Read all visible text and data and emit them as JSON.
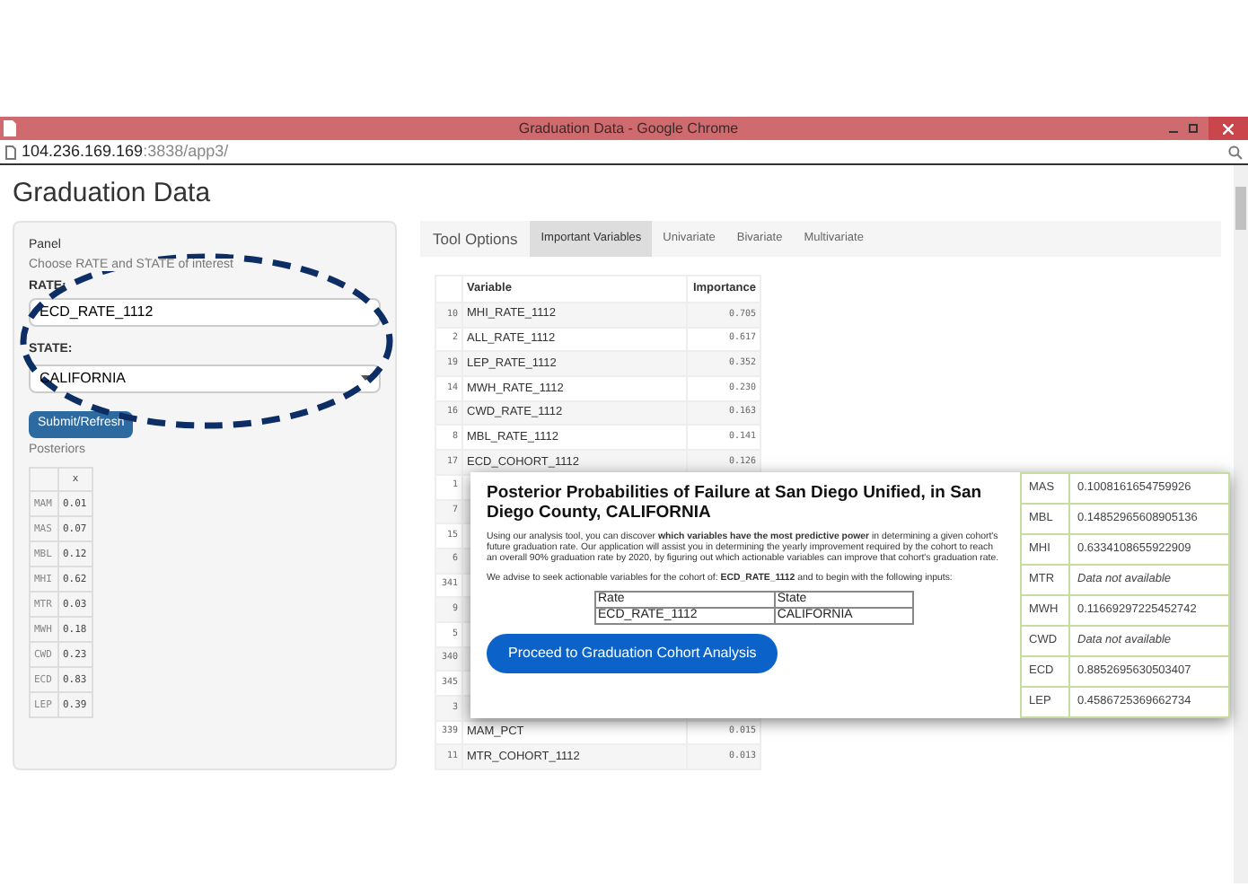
{
  "window": {
    "title": "Graduation Data - Google Chrome"
  },
  "address_bar": {
    "host": "104.236.169.169",
    "path": ":3838/app3/"
  },
  "page_title": "Graduation Data",
  "panel": {
    "title": "Panel",
    "hint": "Choose RATE and STATE of interest",
    "rate_label": "RATE:",
    "rate_value": "ECD_RATE_1112",
    "state_label": "STATE:",
    "state_value": "CALIFORNIA",
    "submit": "Submit/Refresh",
    "posteriors_label": "Posteriors",
    "posteriors_table": {
      "columns": [
        "x"
      ],
      "rows": [
        {
          "name": "MAM",
          "value": "0.01"
        },
        {
          "name": "MAS",
          "value": "0.07"
        },
        {
          "name": "MBL",
          "value": "0.12"
        },
        {
          "name": "MHI",
          "value": "0.62"
        },
        {
          "name": "MTR",
          "value": "0.03"
        },
        {
          "name": "MWH",
          "value": "0.18"
        },
        {
          "name": "CWD",
          "value": "0.23"
        },
        {
          "name": "ECD",
          "value": "0.83"
        },
        {
          "name": "LEP",
          "value": "0.39"
        }
      ]
    }
  },
  "tabs": [
    {
      "label": "Tool Options",
      "kind": "heading"
    },
    {
      "label": "Important Variables",
      "kind": "tab",
      "selected": true
    },
    {
      "label": "Univariate",
      "kind": "tab",
      "selected": false
    },
    {
      "label": "Bivariate",
      "kind": "tab",
      "selected": false
    },
    {
      "label": "Multivariate",
      "kind": "tab",
      "selected": false
    }
  ],
  "importance_table": {
    "columns": [
      "Variable",
      "Importance"
    ],
    "rows": [
      {
        "index": "10",
        "variable": "MHI_RATE_1112",
        "importance": "0.705"
      },
      {
        "index": "2",
        "variable": "ALL_RATE_1112",
        "importance": "0.617"
      },
      {
        "index": "19",
        "variable": "LEP_RATE_1112",
        "importance": "0.352"
      },
      {
        "index": "14",
        "variable": "MWH_RATE_1112",
        "importance": "0.230"
      },
      {
        "index": "16",
        "variable": "CWD_RATE_1112",
        "importance": "0.163"
      },
      {
        "index": "8",
        "variable": "MBL_RATE_1112",
        "importance": "0.141"
      },
      {
        "index": "17",
        "variable": "ECD_COHORT_1112",
        "importance": "0.126"
      },
      {
        "index": "1"
      },
      {
        "index": "7"
      },
      {
        "index": "15"
      },
      {
        "index": "6"
      },
      {
        "index": "341"
      },
      {
        "index": "9"
      },
      {
        "index": "5"
      },
      {
        "index": "340"
      },
      {
        "index": "345"
      },
      {
        "index": "3"
      },
      {
        "index": "339",
        "variable": "MAM_PCT",
        "importance": "0.015"
      },
      {
        "index": "11",
        "variable": "MTR_COHORT_1112",
        "importance": "0.013"
      }
    ]
  },
  "popup": {
    "title": "Posterior Probabilities of Failure at San Diego Unified, in San Diego County, CALIFORNIA",
    "intro": "Using our analysis tool, you can discover **which variables have the most predictive power** in determining a given cohort's future graduation rate. Our application will assist you in determining the yearly improvement required by the cohort to reach an overall 90% graduation rate by 2020, by figuring out which actionable variables can improve that cohort's graduation rate.",
    "advice": "We advise to seek actionable variables for the cohort of: **ECD_RATE_1112** and to begin with the following inputs:",
    "inputs_table": {
      "columns": [
        "Rate",
        "State"
      ],
      "row": [
        "ECD_RATE_1112",
        "CALIFORNIA"
      ]
    },
    "button": "Proceed to Graduation Cohort Analysis",
    "probabilities": [
      {
        "name": "MAS",
        "value": "0.1008161654759926",
        "available": true
      },
      {
        "name": "MBL",
        "value": "0.14852965608905136",
        "available": true
      },
      {
        "name": "MHI",
        "value": "0.6334108655922909",
        "available": true
      },
      {
        "name": "MTR",
        "value": "Data not available",
        "available": false
      },
      {
        "name": "MWH",
        "value": "0.11669297225452742",
        "available": true
      },
      {
        "name": "CWD",
        "value": "Data not available",
        "available": false
      },
      {
        "name": "ECD",
        "value": "0.8852695630503407",
        "available": true
      },
      {
        "name": "LEP",
        "value": "0.4586725369662734",
        "available": true
      }
    ]
  }
}
